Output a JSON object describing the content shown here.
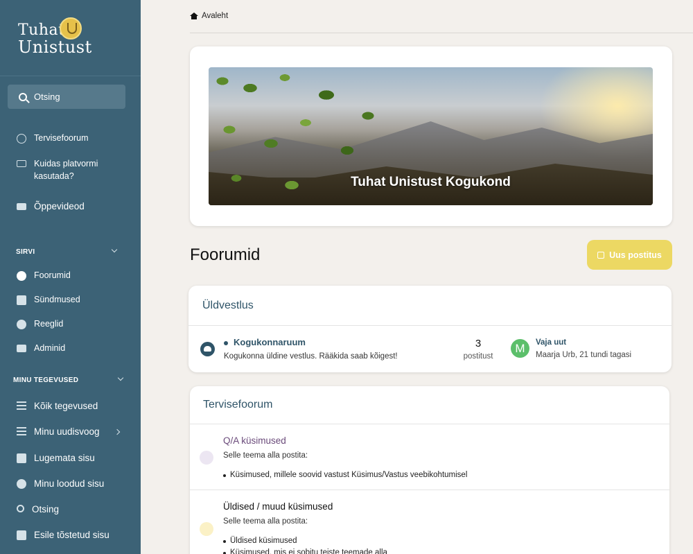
{
  "brand": {
    "line1": "Tuhat",
    "line2": "Unistust"
  },
  "sidebar": {
    "search_label": "Otsing",
    "top_items": [
      {
        "label": "Tervisefoorum",
        "icon": "help-circle-icon"
      },
      {
        "label": "Kuidas platvormi kasutada?",
        "icon": "monitor-icon"
      },
      {
        "label": "Õppevideod",
        "icon": "video-icon"
      }
    ],
    "browse": {
      "heading": "SIRVI",
      "items": [
        {
          "label": "Foorumid",
          "icon": "chat-bubble-icon"
        },
        {
          "label": "Sündmused",
          "icon": "calendar-icon"
        },
        {
          "label": "Reeglid",
          "icon": "check-circle-icon"
        },
        {
          "label": "Adminid",
          "icon": "id-card-icon"
        }
      ]
    },
    "activity": {
      "heading": "MINU TEGEVUSED",
      "items": [
        {
          "label": "Kõik tegevused",
          "icon": "list-icon"
        },
        {
          "label": "Minu uudisvoog",
          "icon": "checklist-icon"
        },
        {
          "label": "Lugemata sisu",
          "icon": "newspaper-icon"
        },
        {
          "label": "Minu loodud sisu",
          "icon": "user-circle-icon"
        },
        {
          "label": "Otsing",
          "icon": "search-icon"
        },
        {
          "label": "Esile tõstetud sisu",
          "icon": "document-icon"
        }
      ]
    }
  },
  "breadcrumb": {
    "home": "Avaleht"
  },
  "hero": {
    "title": "Tuhat Unistust Kogukond"
  },
  "page": {
    "title": "Foorumid",
    "new_post_label": "Uus postitus"
  },
  "categories": [
    {
      "title": "Üldvestlus",
      "forums": [
        {
          "name": "Kogukonnaruum",
          "description": "Kogukonna üldine vestlus. Rääkida saab kõigest!",
          "post_count": "3",
          "post_count_label": "postitust",
          "last_post_title": "Vaja uut",
          "last_post_meta": "Maarja Urb, 21 tundi tagasi",
          "last_post_avatar": "M"
        }
      ]
    },
    {
      "title": "Tervisefoorum",
      "forums": [
        {
          "name": "Q/A küsimused",
          "intro": "Selle teema alla postita:",
          "bullets": [
            "Küsimused, millele soovid vastust Küsimus/Vastus veebikohtumisel"
          ]
        },
        {
          "name": "Üldised / muud küsimused",
          "intro": "Selle teema alla postita:",
          "bullets": [
            "Üldised küsimused",
            "Küsimused, mis ei sobitu teiste teemade alla"
          ]
        }
      ]
    }
  ],
  "colors": {
    "sidebar_bg": "#3c6276",
    "accent_yellow": "#ecd863",
    "link_blue": "#2f5468",
    "qa_purple": "#6a4a7a"
  }
}
